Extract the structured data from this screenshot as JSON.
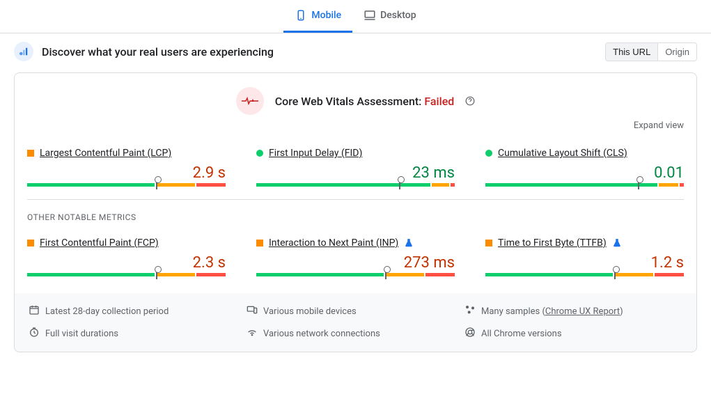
{
  "tabs": {
    "mobile": "Mobile",
    "desktop": "Desktop"
  },
  "discover": {
    "title": "Discover what your real users are experiencing",
    "this_url": "This URL",
    "origin": "Origin"
  },
  "assessment": {
    "text": "Core Web Vitals Assessment: ",
    "status": "Failed",
    "expand": "Expand view"
  },
  "metrics": {
    "primary": [
      {
        "name": "Largest Contentful Paint (LCP)",
        "value": "2.9 s",
        "color": "orange",
        "bullet": "sq-orange",
        "bar": [
          65,
          20,
          15
        ],
        "marker": 65
      },
      {
        "name": "First Input Delay (FID)",
        "value": "23 ms",
        "color": "green",
        "bullet": "rd-green",
        "bar": [
          89,
          9,
          2
        ],
        "marker": 72
      },
      {
        "name": "Cumulative Layout Shift (CLS)",
        "value": "0.01",
        "color": "green",
        "bullet": "rd-green",
        "bar": [
          88,
          10,
          2
        ],
        "marker": 77
      }
    ],
    "other_title": "OTHER NOTABLE METRICS",
    "secondary": [
      {
        "name": "First Contentful Paint (FCP)",
        "value": "2.3 s",
        "color": "orange",
        "bullet": "sq-orange",
        "bar": [
          65,
          20,
          15
        ],
        "marker": 65,
        "flask": false
      },
      {
        "name": "Interaction to Next Paint (INP)",
        "value": "273 ms",
        "color": "orange",
        "bullet": "sq-orange",
        "bar": [
          65,
          20,
          15
        ],
        "marker": 65,
        "flask": true
      },
      {
        "name": "Time to First Byte (TTFB)",
        "value": "1.2 s",
        "color": "orange",
        "bullet": "sq-orange",
        "bar": [
          65,
          20,
          15
        ],
        "marker": 65,
        "flask": true
      }
    ]
  },
  "footer": [
    {
      "icon": "calendar",
      "text": "Latest 28-day collection period"
    },
    {
      "icon": "devices",
      "text": "Various mobile devices"
    },
    {
      "icon": "samples",
      "text": "Many samples ",
      "link": "Chrome UX Report"
    },
    {
      "icon": "clock",
      "text": "Full visit durations"
    },
    {
      "icon": "wifi",
      "text": "Various network connections"
    },
    {
      "icon": "chrome",
      "text": "All Chrome versions"
    }
  ]
}
